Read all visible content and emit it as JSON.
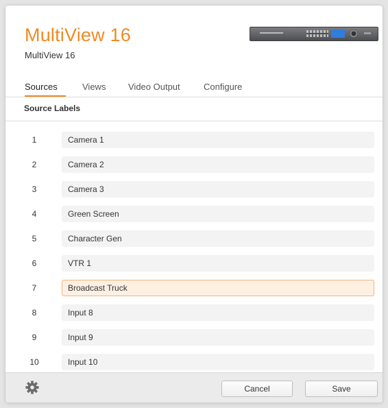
{
  "header": {
    "app_title": "MultiView 16",
    "device_name": "MultiView 16",
    "device_image_icon": "multiview-device-front-panel"
  },
  "tabs": [
    {
      "label": "Sources",
      "active": true
    },
    {
      "label": "Views",
      "active": false
    },
    {
      "label": "Video Output",
      "active": false
    },
    {
      "label": "Configure",
      "active": false
    }
  ],
  "section": {
    "title": "Source Labels"
  },
  "sources": [
    {
      "number": "1",
      "label": "Camera 1"
    },
    {
      "number": "2",
      "label": "Camera 2"
    },
    {
      "number": "3",
      "label": "Camera 3"
    },
    {
      "number": "4",
      "label": "Green Screen"
    },
    {
      "number": "5",
      "label": "Character Gen"
    },
    {
      "number": "6",
      "label": "VTR 1"
    },
    {
      "number": "7",
      "label": "Broadcast Truck",
      "focused": true
    },
    {
      "number": "8",
      "label": "Input 8"
    },
    {
      "number": "9",
      "label": "Input 9"
    },
    {
      "number": "10",
      "label": "Input 10"
    }
  ],
  "footer": {
    "settings_icon": "gear-icon",
    "cancel_label": "Cancel",
    "save_label": "Save"
  },
  "colors": {
    "accent": "#f08a24",
    "focused_field_bg": "#fdf0e3",
    "focused_field_border": "#f0b47a"
  }
}
